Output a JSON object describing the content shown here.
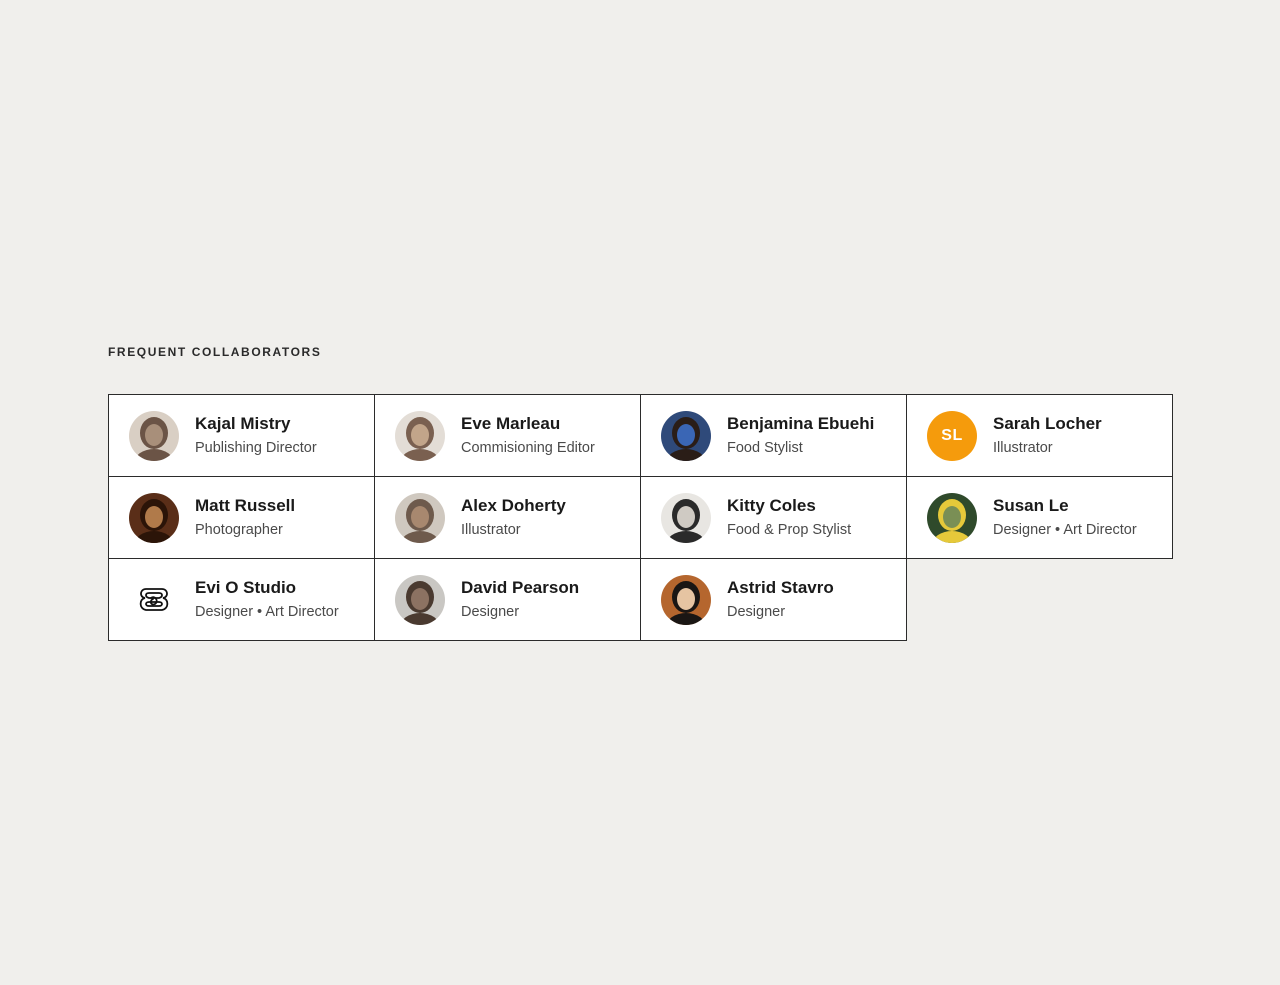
{
  "section": {
    "title": "FREQUENT COLLABORATORS"
  },
  "collaborators": [
    {
      "name": "Kajal Mistry",
      "role": "Publishing Director",
      "avatar": "photo",
      "colors": [
        "#d9cfc4",
        "#6b5446",
        "#a88f7a"
      ]
    },
    {
      "name": "Eve Marleau",
      "role": "Commisioning Editor",
      "avatar": "photo",
      "colors": [
        "#e3ddd6",
        "#7a6050",
        "#c2a58a"
      ]
    },
    {
      "name": "Benjamina Ebuehi",
      "role": "Food Stylist",
      "avatar": "photo",
      "colors": [
        "#2f4a7a",
        "#2a1d17",
        "#3a66b5"
      ]
    },
    {
      "name": "Sarah Locher",
      "role": "Illustrator",
      "avatar": "initials",
      "initials": "SL",
      "colors": [
        "#f59b0c"
      ]
    },
    {
      "name": "Matt Russell",
      "role": "Photographer",
      "avatar": "photo",
      "colors": [
        "#5a2e18",
        "#2b1408",
        "#b07a4a"
      ]
    },
    {
      "name": "Alex Doherty",
      "role": "Illustrator",
      "avatar": "photo",
      "colors": [
        "#cfc8bf",
        "#6e5a4c",
        "#a8886f"
      ]
    },
    {
      "name": "Kitty Coles",
      "role": "Food & Prop Stylist",
      "avatar": "photo",
      "colors": [
        "#e8e6e2",
        "#2a2a2a",
        "#cfcac3"
      ]
    },
    {
      "name": "Susan Le",
      "role": "Designer • Art Director",
      "avatar": "photo",
      "colors": [
        "#2f4a2b",
        "#e6c93a",
        "#7a8f55"
      ]
    },
    {
      "name": "Evi O Studio",
      "role": "Designer • Art Director",
      "avatar": "logo",
      "colors": [
        "#ffffff",
        "#111111"
      ]
    },
    {
      "name": "David Pearson",
      "role": "Designer",
      "avatar": "photo",
      "colors": [
        "#c9c7c3",
        "#4a3a30",
        "#8c7262"
      ]
    },
    {
      "name": "Astrid Stavro",
      "role": "Designer",
      "avatar": "photo",
      "colors": [
        "#b5662e",
        "#1a1614",
        "#e6c4a2"
      ]
    }
  ]
}
